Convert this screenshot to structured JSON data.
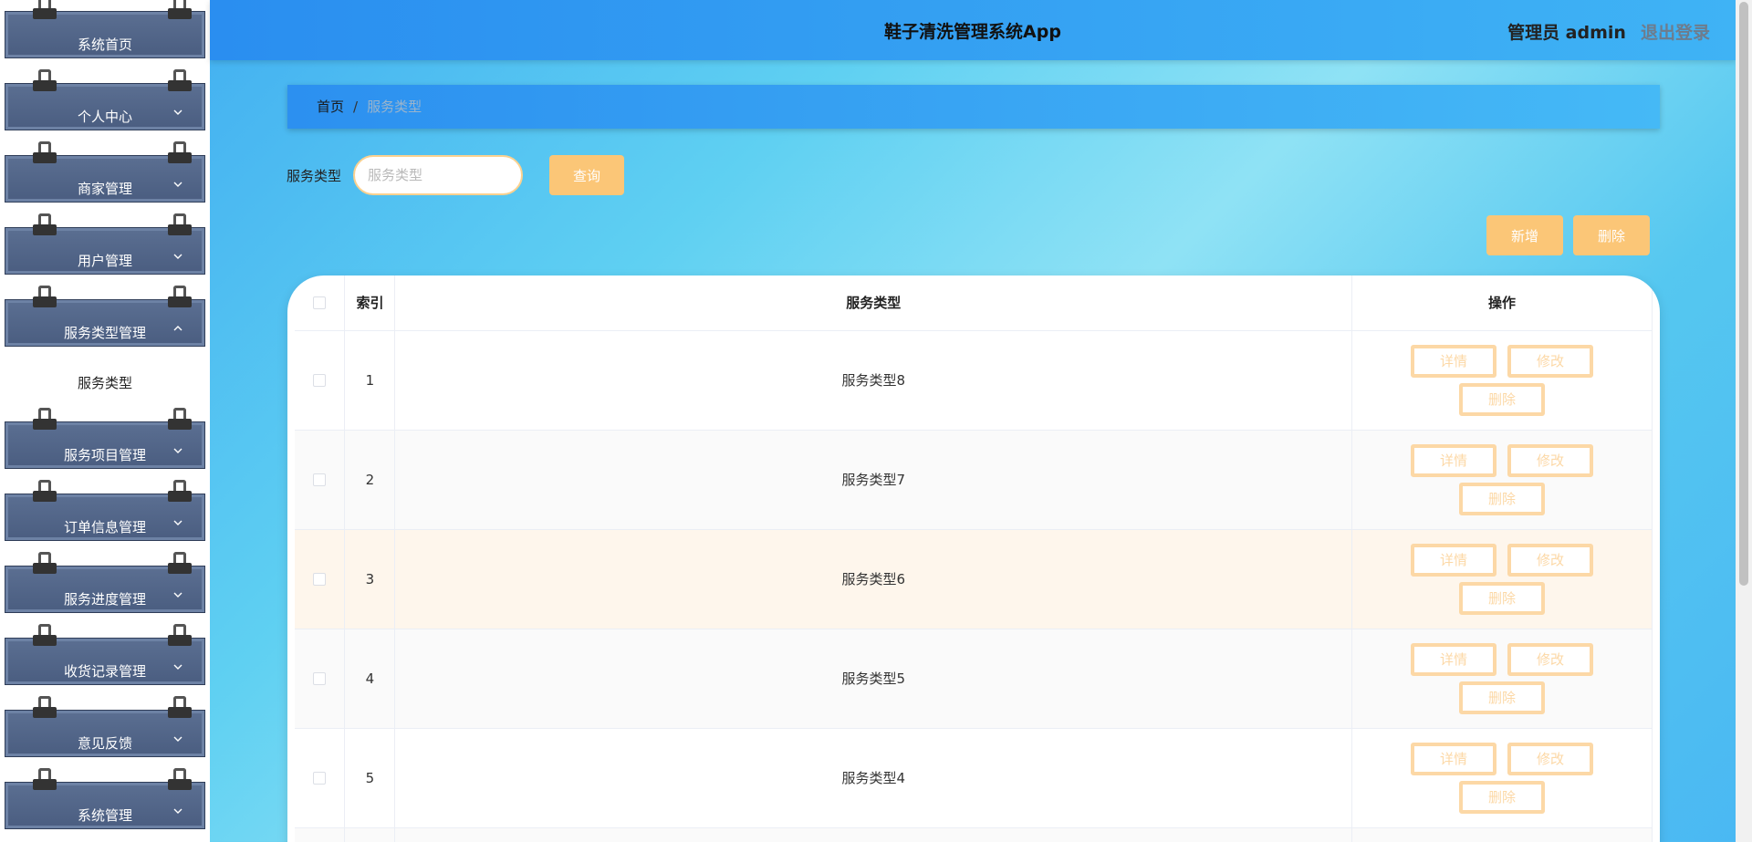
{
  "header": {
    "app_title": "鞋子清洗管理系统App",
    "user_label": "管理员 admin",
    "logout_label": "退出登录"
  },
  "sidebar": {
    "items": [
      {
        "label": "系统首页",
        "has_chevron": false
      },
      {
        "label": "个人中心",
        "has_chevron": true,
        "chevron": "down"
      },
      {
        "label": "商家管理",
        "has_chevron": true,
        "chevron": "down"
      },
      {
        "label": "用户管理",
        "has_chevron": true,
        "chevron": "down"
      },
      {
        "label": "服务类型管理",
        "has_chevron": true,
        "chevron": "up"
      },
      {
        "label": "服务项目管理",
        "has_chevron": true,
        "chevron": "down"
      },
      {
        "label": "订单信息管理",
        "has_chevron": true,
        "chevron": "down"
      },
      {
        "label": "服务进度管理",
        "has_chevron": true,
        "chevron": "down"
      },
      {
        "label": "收货记录管理",
        "has_chevron": true,
        "chevron": "down"
      },
      {
        "label": "意见反馈",
        "has_chevron": true,
        "chevron": "down"
      },
      {
        "label": "系统管理",
        "has_chevron": true,
        "chevron": "down"
      }
    ],
    "submenu_active": "服务类型"
  },
  "breadcrumb": {
    "home": "首页",
    "separator": "/",
    "current": "服务类型"
  },
  "search": {
    "label": "服务类型",
    "placeholder": "服务类型",
    "value": "",
    "query_button": "查询"
  },
  "actions": {
    "add_button": "新增",
    "delete_button": "删除"
  },
  "table": {
    "headers": {
      "index": "索引",
      "service_type": "服务类型",
      "operations": "操作"
    },
    "rows": [
      {
        "index": "1",
        "service_type": "服务类型8"
      },
      {
        "index": "2",
        "service_type": "服务类型7"
      },
      {
        "index": "3",
        "service_type": "服务类型6"
      },
      {
        "index": "4",
        "service_type": "服务类型5"
      },
      {
        "index": "5",
        "service_type": "服务类型4"
      }
    ],
    "row_buttons": {
      "detail": "详情",
      "edit": "修改",
      "delete": "删除"
    }
  },
  "colors": {
    "accent": "#fbc677",
    "header_blue": "#2a8ef0",
    "sidebar_item": "#4a5d80"
  }
}
